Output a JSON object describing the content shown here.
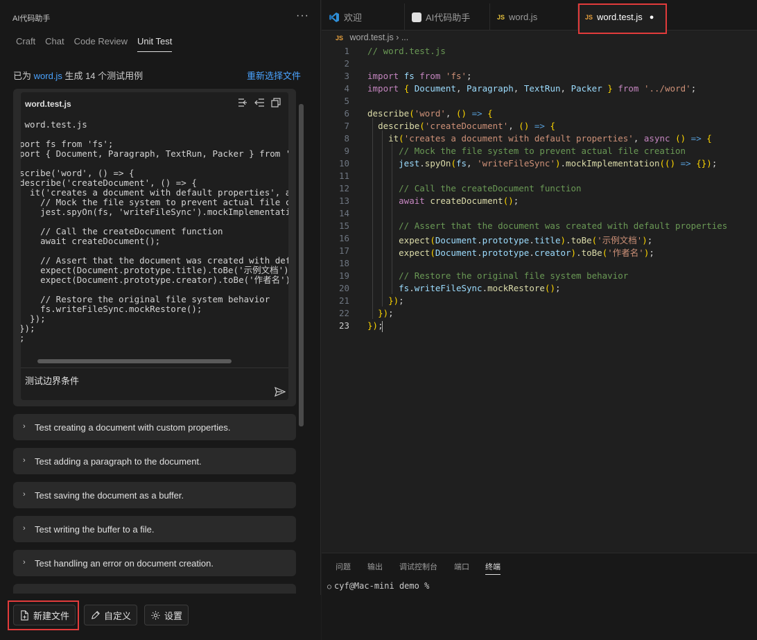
{
  "left": {
    "header_title": "AI代码助手",
    "more": "···",
    "tabs": [
      "Craft",
      "Chat",
      "Code Review",
      "Unit Test"
    ],
    "status_prefix": "已为",
    "status_file": "word.js",
    "status_suffix": "生成 14 个测试用例",
    "reselect": "重新选择文件",
    "code_card": {
      "title": "word.test.js",
      "code": " word.test.js\n\nport fs from 'fs';\nport { Document, Paragraph, TextRun, Packer } from '../\n\nscribe('word', () => {\ndescribe('createDocument', () => {\n  it('creates a document with default properties', asy\n    // Mock the file system to prevent actual file cre\n    jest.spyOn(fs, 'writeFileSync').mockImplementation\n\n    // Call the createDocument function\n    await createDocument();\n\n    // Assert that the document was created with defau\n    expect(Document.prototype.title).toBe('示例文档');\n    expect(Document.prototype.creator).toBe('作者名');\n\n    // Restore the original file system behavior\n    fs.writeFileSync.mockRestore();\n  });\n});\n;",
      "prompt": "测试边界条件"
    },
    "tests": [
      "Test creating a document with custom properties.",
      "Test adding a paragraph to the document.",
      "Test saving the document as a buffer.",
      "Test writing the buffer to a file.",
      "Test handling an error on document creation."
    ],
    "buttons": {
      "new_file": "新建文件",
      "customize": "自定义",
      "settings": "设置"
    }
  },
  "editor": {
    "tabs": [
      {
        "label": "欢迎",
        "icon": "vscode-icon"
      },
      {
        "label": "AI代码助手",
        "icon": "extension-icon"
      },
      {
        "label": "word.js",
        "icon": "JS"
      },
      {
        "label": "word.test.js",
        "icon": "JS",
        "modified_dot": "●"
      }
    ],
    "breadcrumb": {
      "icon": "JS",
      "file": "word.test.js",
      "rest": "›  ..."
    },
    "line_numbers": [
      "1",
      "2",
      "3",
      "4",
      "5",
      "6",
      "7",
      "8",
      "9",
      "10",
      "11",
      "12",
      "13",
      "14",
      "15",
      "16",
      "17",
      "18",
      "19",
      "20",
      "21",
      "22",
      "23"
    ],
    "lines": [
      "// word.test.js",
      "",
      "import fs from 'fs';",
      "import { Document, Paragraph, TextRun, Packer } from '../word';",
      "",
      "describe('word', () => {",
      "  describe('createDocument', () => {",
      "    it('creates a document with default properties', async () => {",
      "      // Mock the file system to prevent actual file creation",
      "      jest.spyOn(fs, 'writeFileSync').mockImplementation(() => {});",
      "",
      "      // Call the createDocument function",
      "      await createDocument();",
      "",
      "      // Assert that the document was created with default properties",
      "      expect(Document.prototype.title).toBe('示例文档');",
      "      expect(Document.prototype.creator).toBe('作者名');",
      "",
      "      // Restore the original file system behavior",
      "      fs.writeFileSync.mockRestore();",
      "    });",
      "  });",
      "});"
    ]
  },
  "panel": {
    "tabs": [
      "问题",
      "输出",
      "调试控制台",
      "端口",
      "终端"
    ],
    "terminal_line": "cyf@Mac-mini demo %"
  }
}
